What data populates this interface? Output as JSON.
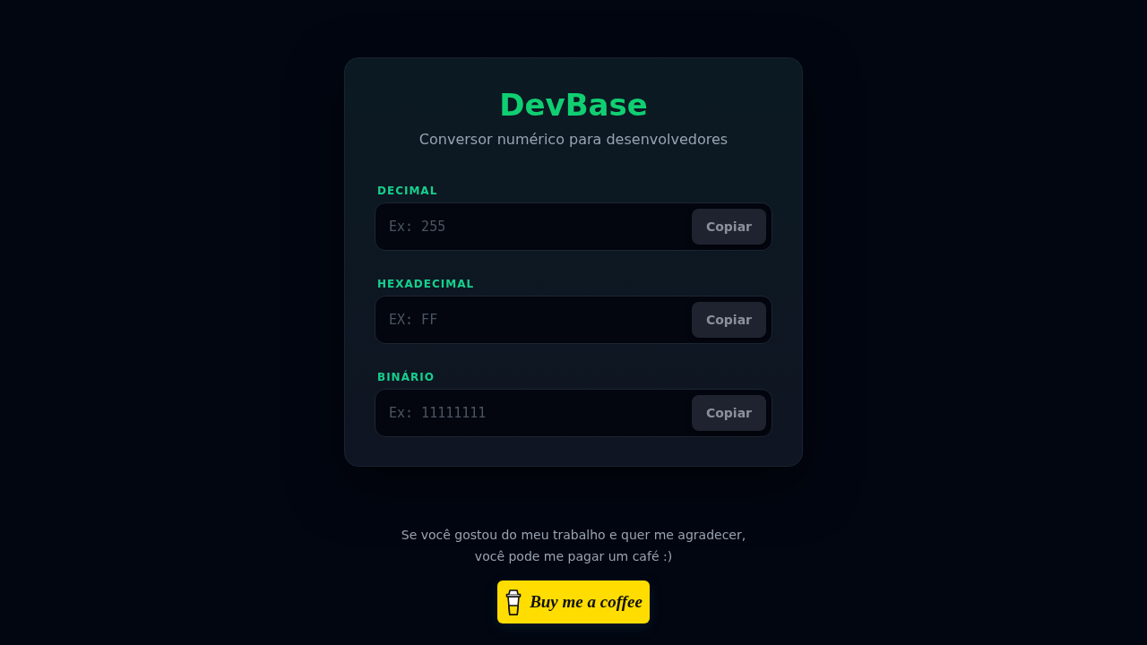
{
  "app": {
    "title": "DevBase",
    "subtitle": "Conversor numérico para desenvolvedores"
  },
  "fields": [
    {
      "label": "DECIMAL",
      "placeholder": "Ex: 255",
      "button": "Copiar"
    },
    {
      "label": "HEXADECIMAL",
      "placeholder": "EX: FF",
      "button": "Copiar"
    },
    {
      "label": "BINÁRIO",
      "placeholder": "Ex: 11111111",
      "button": "Copiar"
    }
  ],
  "support": {
    "message": "Se você gostou do meu trabalho e quer me agradecer, você pode me pagar um café :)",
    "button": "Buy me a coffee"
  }
}
